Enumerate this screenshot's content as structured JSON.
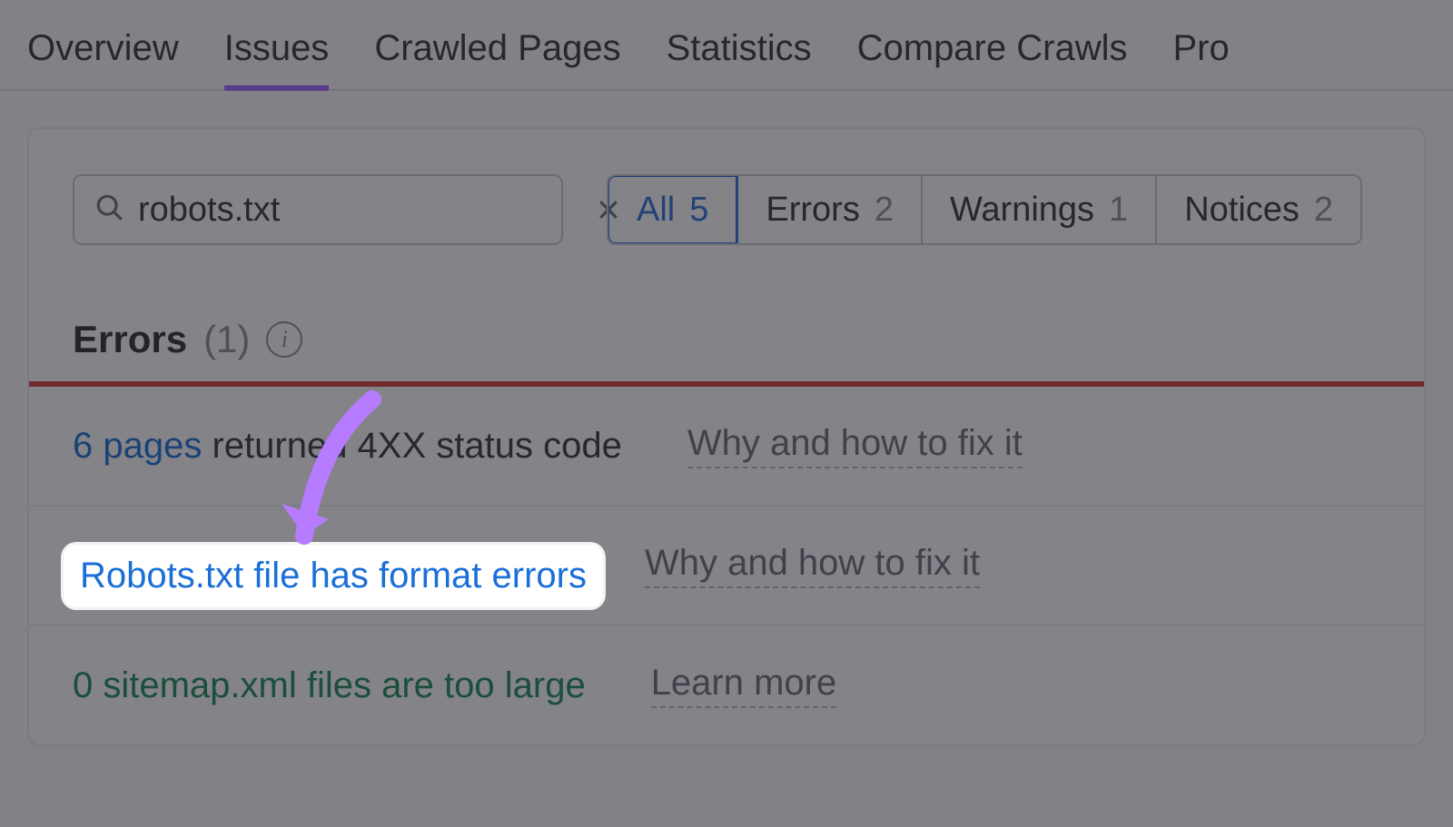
{
  "tabs": {
    "items": [
      "Overview",
      "Issues",
      "Crawled Pages",
      "Statistics",
      "Compare Crawls",
      "Pro"
    ],
    "activeIndex": 1
  },
  "search": {
    "value": "robots.txt"
  },
  "filters": {
    "items": [
      {
        "label": "All",
        "count": "5"
      },
      {
        "label": "Errors",
        "count": "2"
      },
      {
        "label": "Warnings",
        "count": "1"
      },
      {
        "label": "Notices",
        "count": "2"
      }
    ],
    "activeIndex": 0
  },
  "section": {
    "title": "Errors",
    "count": "(1)"
  },
  "rows": {
    "r1": {
      "link": "6 pages",
      "text": " returned 4XX status code",
      "help": "Why and how to fix it"
    },
    "r2": {
      "link": "Robots.txt file has format errors",
      "help": "Why and how to fix it"
    },
    "r3": {
      "link": "0 sitemap.xml files are too large",
      "help": "Learn more"
    }
  },
  "highlight": {
    "text": "Robots.txt file has format errors"
  }
}
